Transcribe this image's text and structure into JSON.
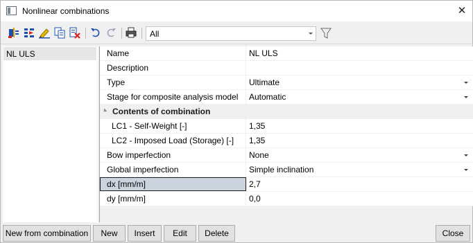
{
  "window": {
    "title": "Nonlinear combinations",
    "close_glyph": "✕"
  },
  "toolbar": {
    "icons": [
      "new-combination-icon",
      "insert-icon",
      "edit-icon",
      "copy-icon",
      "delete-icon",
      "undo-icon",
      "redo-icon",
      "print-icon",
      "filter-icon"
    ],
    "filter_value": "All"
  },
  "list": {
    "items": [
      {
        "label": "NL ULS"
      }
    ]
  },
  "properties": {
    "rows": [
      {
        "name": "Name",
        "value": "NL ULS"
      },
      {
        "name": "Description",
        "value": ""
      },
      {
        "name": "Type",
        "value": "Ultimate"
      },
      {
        "name": "Stage for composite analysis model",
        "value": "Automatic"
      },
      {
        "name": "Contents of combination"
      },
      {
        "name": "LC1 - Self-Weight [-]",
        "value": "1,35"
      },
      {
        "name": "LC2 - Imposed Load (Storage) [-]",
        "value": "1,35"
      },
      {
        "name": "Bow imperfection",
        "value": "None"
      },
      {
        "name": "Global imperfection",
        "value": "Simple inclination"
      },
      {
        "name": "dx [mm/m]",
        "value": "2,7"
      },
      {
        "name": "dy [mm/m]",
        "value": "0,0"
      }
    ]
  },
  "footer": {
    "new_from_combination": "New from combination",
    "new": "New",
    "insert": "Insert",
    "edit": "Edit",
    "delete": "Delete",
    "close": "Close"
  }
}
